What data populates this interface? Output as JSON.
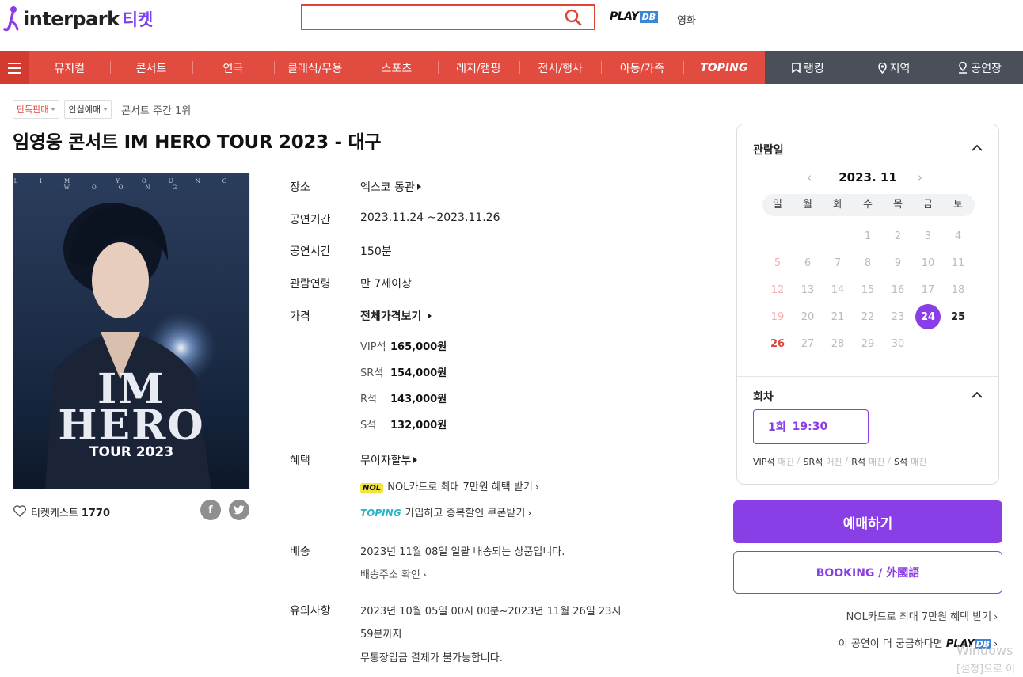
{
  "header": {
    "logo": "interpark",
    "logo_sub": "티켓",
    "search_placeholder": "",
    "playdb_text": "PLAY",
    "playdb_box": "DB",
    "movie_link": "영화"
  },
  "nav": {
    "items": [
      "뮤지컬",
      "콘서트",
      "연극",
      "클래식/무용",
      "스포츠",
      "레저/캠핑",
      "전시/행사",
      "아동/가족",
      "TOPING"
    ],
    "right": [
      "랭킹",
      "지역",
      "공연장"
    ],
    "colors": {
      "nav_bg": "#e24b40",
      "nav_right_bg": "#4b4f5a",
      "accent": "#8a3ee6"
    }
  },
  "tags": {
    "exclusive": "단독판매",
    "safe": "안심예매",
    "rank": "콘서트 주간 1위"
  },
  "title": "임영웅 콘서트 IM HERO TOUR 2023 - 대구",
  "poster": {
    "top_text": "LIM YOUNG WOONG",
    "line1": "IM",
    "line2": "HERO",
    "tour": "TOUR 2023"
  },
  "ticketcast": {
    "label": "티켓캐스트",
    "count": "1770"
  },
  "info": {
    "venue_label": "장소",
    "venue": "엑스코 동관",
    "period_label": "공연기간",
    "period": "2023.11.24 ~2023.11.26",
    "duration_label": "공연시간",
    "duration": "150분",
    "age_label": "관람연령",
    "age": "만 7세이상",
    "price_label": "가격",
    "price_all": "전체가격보기",
    "prices": [
      {
        "grade": "VIP석",
        "amount": "165,000원"
      },
      {
        "grade": "SR석",
        "amount": "154,000원"
      },
      {
        "grade": "R석",
        "amount": "143,000원"
      },
      {
        "grade": "S석",
        "amount": "132,000원"
      }
    ],
    "benefit_label": "혜택",
    "benefit": "무이자할부",
    "nol_badge": "NOL",
    "nol_text": "NOL카드로 최대 7만원 혜택 받기",
    "toping_badge": "TOPING",
    "toping_text": "가입하고 중복할인 쿠폰받기",
    "delivery_label": "배송",
    "delivery": "2023년 11월 08일 일괄 배송되는 상품입니다.",
    "delivery_link": "배송주소 확인",
    "notice_label": "유의사항",
    "notice_line1": "2023년 10월 05일 00시 00분~2023년 11월 26일 23시",
    "notice_line2": "59분까지",
    "notice_line3": "무통장입금 결제가 불가능합니다."
  },
  "calendar": {
    "heading": "관람일",
    "month": "2023. 11",
    "weekdays": [
      "일",
      "월",
      "화",
      "수",
      "목",
      "금",
      "토"
    ],
    "days": [
      "",
      "",
      "",
      "1",
      "2",
      "3",
      "4",
      "5",
      "6",
      "7",
      "8",
      "9",
      "10",
      "11",
      "12",
      "13",
      "14",
      "15",
      "16",
      "17",
      "18",
      "19",
      "20",
      "21",
      "22",
      "23",
      "24",
      "25",
      "26",
      "27",
      "28",
      "29",
      "30",
      "",
      ""
    ],
    "selected": "24",
    "available": [
      "24",
      "25",
      "26"
    ]
  },
  "round": {
    "heading": "회차",
    "option_no": "1회",
    "option_time": "19:30",
    "seats": [
      {
        "grade": "VIP석",
        "status": "매진"
      },
      {
        "grade": "SR석",
        "status": "매진"
      },
      {
        "grade": "R석",
        "status": "매진"
      },
      {
        "grade": "S석",
        "status": "매진"
      }
    ]
  },
  "actions": {
    "book": "예매하기",
    "book_foreign": "BOOKING / 外國語",
    "nol_link": "NOL카드로 최대 7만원 혜택 받기",
    "playdb_link": "이 공연이 더 궁금하다면",
    "playdb_link_text": "PLAY",
    "playdb_link_box": "DB"
  },
  "windows": {
    "line1": "Windows",
    "line2": "[설정]으로 이"
  }
}
